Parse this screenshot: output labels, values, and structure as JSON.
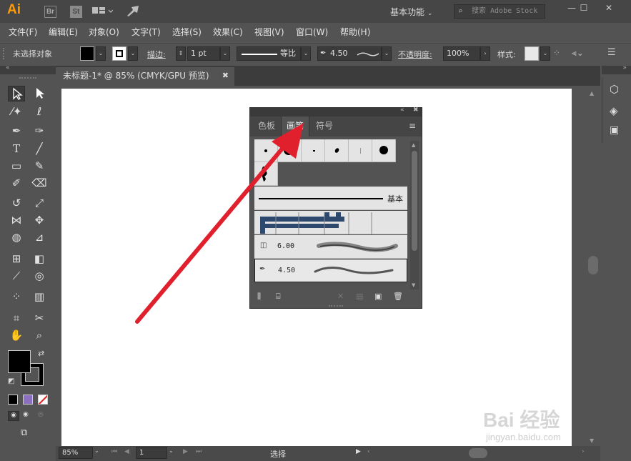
{
  "app": {
    "logo": "Ai",
    "bridge": "Br",
    "stock": "St",
    "workspace": "基本功能",
    "search_placeholder": "搜索 Adobe Stock"
  },
  "menu": [
    "文件(F)",
    "编辑(E)",
    "对象(O)",
    "文字(T)",
    "选择(S)",
    "效果(C)",
    "视图(V)",
    "窗口(W)",
    "帮助(H)"
  ],
  "control": {
    "no_selection": "未选择对象",
    "stroke_label": "描边",
    "stroke_weight": "1 pt",
    "profile_label": "等比",
    "brush_size": "4.50",
    "opacity_label": "不透明度",
    "opacity_value": "100%",
    "style_label": "样式"
  },
  "document": {
    "tab_title": "未标题-1* @ 85% (CMYK/GPU 预览)",
    "zoom": "85%",
    "page": "1",
    "status_tool": "选择"
  },
  "brush_panel": {
    "tabs": [
      "色板",
      "画笔",
      "符号"
    ],
    "active_tab": "画笔",
    "basic_label": "基本",
    "bristle_1_size": "6.00",
    "bristle_2_size": "4.50"
  },
  "colors": {
    "accent_arrow": "#e0202c",
    "ai_orange": "#ff9a00",
    "fill": "#000000"
  },
  "watermark": {
    "line1": "Bai 经验",
    "line2": "jingyan.baidu.com"
  }
}
